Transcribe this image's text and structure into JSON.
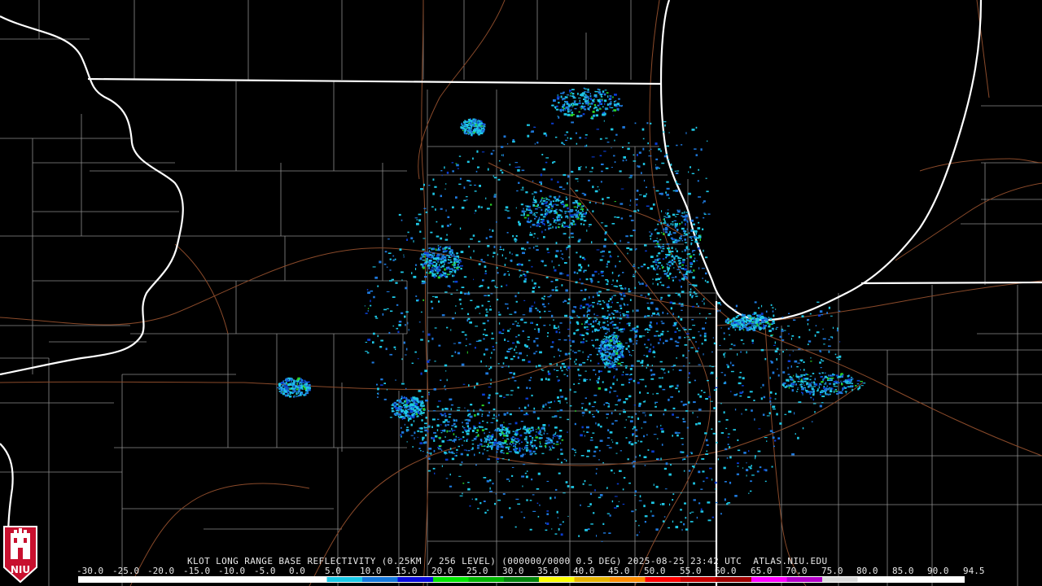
{
  "radar": {
    "caption": "KLOT LONG RANGE BASE REFLECTIVITY (0.25KM / 256 LEVEL) (000000/0000 0.5 DEG) 2025-08-25 23:42 UTC  ATLAS.NIU.EDU"
  },
  "scale": {
    "labels": [
      "-30.0",
      "-25.0",
      "-20.0",
      "-15.0",
      "-10.0",
      "-5.0",
      "0.0",
      "5.0",
      "10.0",
      "15.0",
      "20.0",
      "25.0",
      "30.0",
      "35.0",
      "40.0",
      "45.0",
      "50.0",
      "55.0",
      "60.0",
      "65.0",
      "70.0",
      "75.0",
      "80.0",
      "85.0",
      "90.0",
      "94.5"
    ],
    "colors": [
      "#ffffff",
      "#ffffff",
      "#ffffff",
      "#ffffff",
      "#ffffff",
      "#ffffff",
      "#ffffff",
      "#19c8e6",
      "#1478dc",
      "#0a0adc",
      "#00e600",
      "#00b400",
      "#00820a",
      "#ffff00",
      "#e6b400",
      "#ff8c00",
      "#ff0000",
      "#c80000",
      "#a00000",
      "#ff00ff",
      "#b400c8",
      "#dcdcdc",
      "#ffffff",
      "#ffffff",
      "#ffffff"
    ]
  },
  "logo": {
    "text": "NIU",
    "color": "#c8102e"
  },
  "map": {
    "state_line_color": "#ffffff",
    "county_line_color": "#8c8c8c",
    "road_color": "#8a4a2a",
    "echo_colors": [
      "#1ec8e6",
      "#1e78dc",
      "#0a3cd2",
      "#28d228"
    ]
  }
}
